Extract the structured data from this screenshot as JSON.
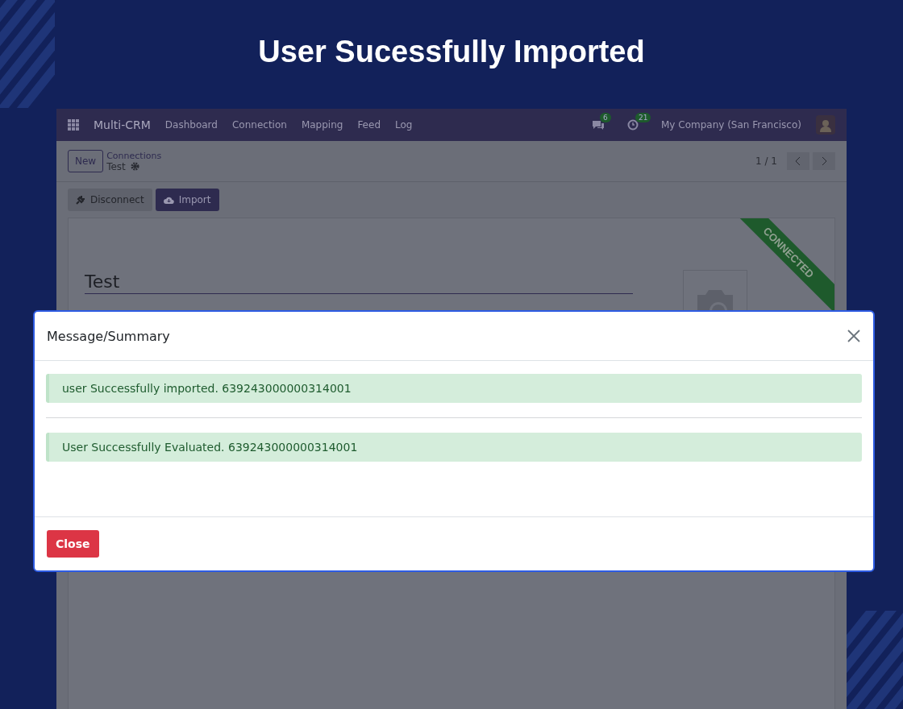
{
  "page_title": "User Sucessfully Imported",
  "navbar": {
    "app_name": "Multi-CRM",
    "menu": [
      "Dashboard",
      "Connection",
      "Mapping",
      "Feed",
      "Log"
    ],
    "messages_badge": "6",
    "activities_badge": "21",
    "company": "My Company (San Francisco)"
  },
  "control_panel": {
    "new_button": "New",
    "breadcrumb": "Connections",
    "record": "Test",
    "pager": "1 / 1"
  },
  "actions": [
    {
      "label": "Disconnect",
      "kind": "secondary"
    },
    {
      "label": "Import",
      "kind": "primary"
    }
  ],
  "form": {
    "name": "Test",
    "ribbon": "CONNECTED"
  },
  "dialog": {
    "title": "Message/Summary",
    "messages": [
      "user Successfully imported. 639243000000314001",
      "User Successfully Evaluated. 639243000000314001"
    ],
    "close_button": "Close"
  }
}
